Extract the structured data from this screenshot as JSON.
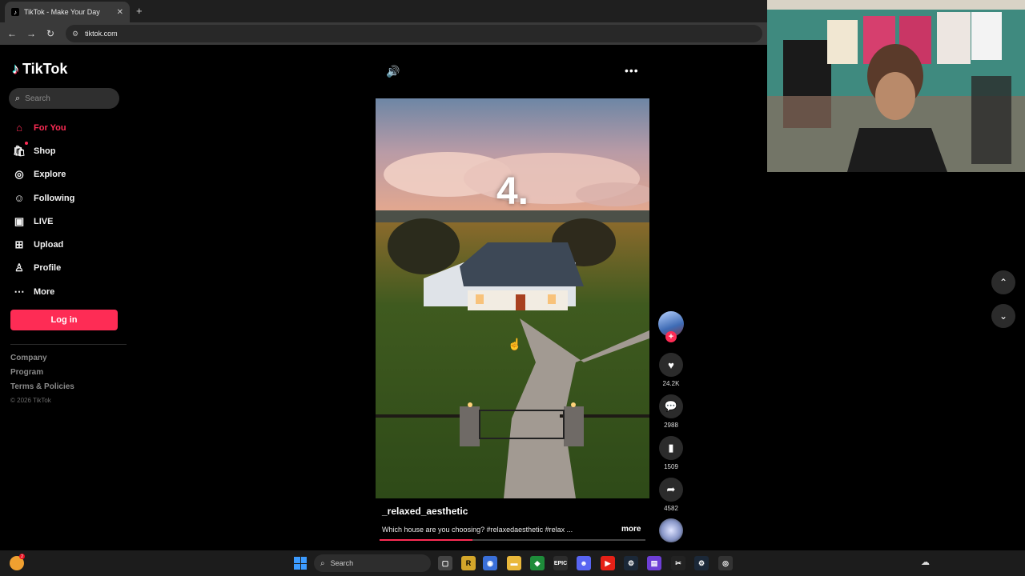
{
  "browser": {
    "tab_title": "TikTok - Make Your Day",
    "tab_close": "✕",
    "new_tab": "+",
    "url": "tiktok.com"
  },
  "sidebar": {
    "logo_text": "TikTok",
    "search_placeholder": "Search",
    "items": [
      {
        "label": "For You",
        "icon": "home-icon",
        "glyph": "⌂",
        "active": true
      },
      {
        "label": "Shop",
        "icon": "shopping-bag-icon",
        "glyph": "🛍",
        "active": false
      },
      {
        "label": "Explore",
        "icon": "compass-icon",
        "glyph": "◎",
        "active": false
      },
      {
        "label": "Following",
        "icon": "following-user-icon",
        "glyph": "☺",
        "active": false
      },
      {
        "label": "LIVE",
        "icon": "live-tv-icon",
        "glyph": "▣",
        "active": false
      },
      {
        "label": "Upload",
        "icon": "upload-plus-icon",
        "glyph": "⊞",
        "active": false
      },
      {
        "label": "Profile",
        "icon": "profile-user-icon",
        "glyph": "♙",
        "active": false
      },
      {
        "label": "More",
        "icon": "more-dots-icon",
        "glyph": "⋯",
        "active": false
      }
    ],
    "login_label": "Log in",
    "footer_links": [
      "Company",
      "Program",
      "Terms & Policies"
    ],
    "copyright": "© 2026 TikTok"
  },
  "video": {
    "overlay_text": "4.",
    "author": "_relaxed_aesthetic",
    "caption": "Which house are you choosing? #relaxedaesthetic #relax ...",
    "more_label": "more",
    "progress_fraction": 0.35
  },
  "actions": {
    "likes": "24.2K",
    "comments": "2988",
    "saves": "1509",
    "shares": "4582"
  },
  "taskbar": {
    "search_placeholder": "Search",
    "notification_count": "2"
  },
  "colors": {
    "accent": "#fe2c55",
    "background": "#000000"
  }
}
